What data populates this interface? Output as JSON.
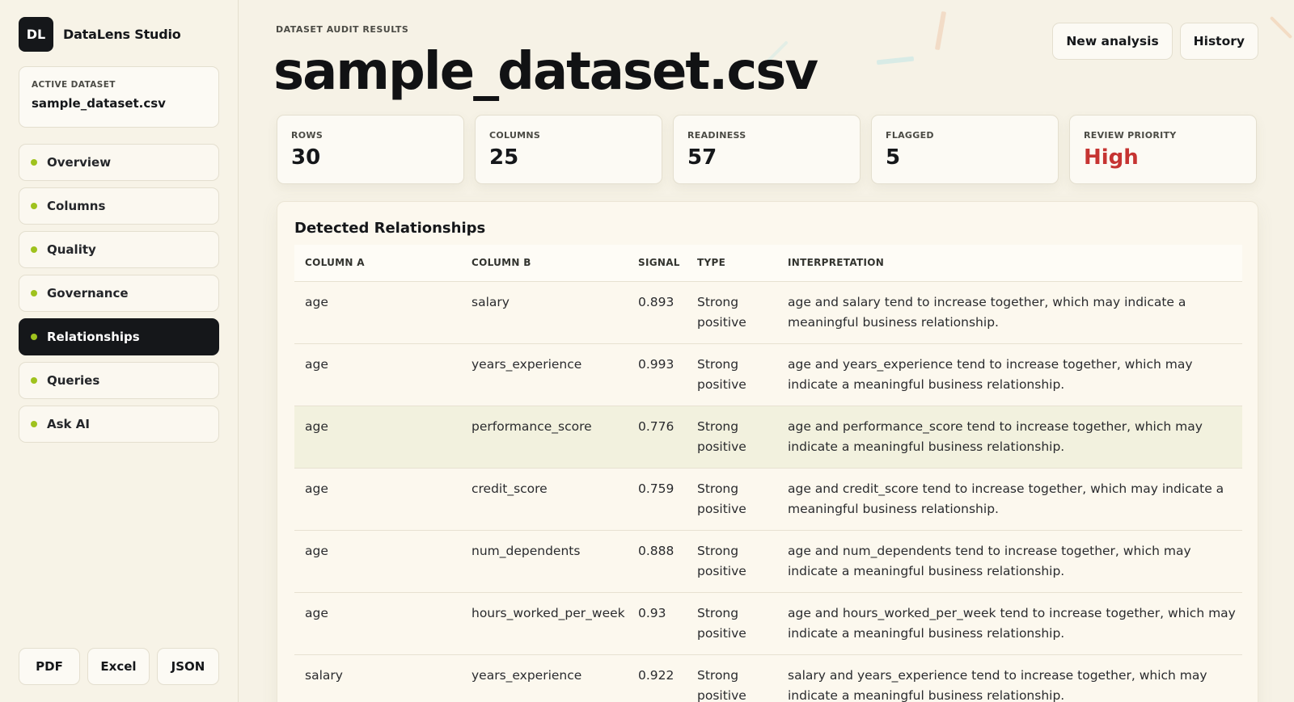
{
  "brand": {
    "logo": "DL",
    "name": "DataLens Studio"
  },
  "active_dataset": {
    "label": "ACTIVE DATASET",
    "value": "sample_dataset.csv"
  },
  "nav": {
    "items": [
      {
        "label": "Overview",
        "active": false
      },
      {
        "label": "Columns",
        "active": false
      },
      {
        "label": "Quality",
        "active": false
      },
      {
        "label": "Governance",
        "active": false
      },
      {
        "label": "Relationships",
        "active": true
      },
      {
        "label": "Queries",
        "active": false
      },
      {
        "label": "Ask AI",
        "active": false
      }
    ]
  },
  "exports": {
    "pdf": "PDF",
    "excel": "Excel",
    "json": "JSON"
  },
  "header": {
    "eyebrow": "DATASET AUDIT RESULTS",
    "title": "sample_dataset.csv",
    "new_analysis": "New analysis",
    "history": "History"
  },
  "stats": [
    {
      "label": "ROWS",
      "value": "30"
    },
    {
      "label": "COLUMNS",
      "value": "25"
    },
    {
      "label": "READINESS",
      "value": "57"
    },
    {
      "label": "FLAGGED",
      "value": "5"
    },
    {
      "label": "REVIEW PRIORITY",
      "value": "High"
    }
  ],
  "relationships": {
    "title": "Detected Relationships",
    "columns": [
      "COLUMN A",
      "COLUMN B",
      "SIGNAL",
      "TYPE",
      "INTERPRETATION"
    ],
    "rows": [
      {
        "a": "age",
        "b": "salary",
        "signal": "0.893",
        "type": "Strong positive",
        "interpretation": "age and salary tend to increase together, which may indicate a meaningful business relationship."
      },
      {
        "a": "age",
        "b": "years_experience",
        "signal": "0.993",
        "type": "Strong positive",
        "interpretation": "age and years_experience tend to increase together, which may indicate a meaningful business relationship."
      },
      {
        "a": "age",
        "b": "performance_score",
        "signal": "0.776",
        "type": "Strong positive",
        "interpretation": "age and performance_score tend to increase together, which may indicate a meaningful business relationship."
      },
      {
        "a": "age",
        "b": "credit_score",
        "signal": "0.759",
        "type": "Strong positive",
        "interpretation": "age and credit_score tend to increase together, which may indicate a meaningful business relationship."
      },
      {
        "a": "age",
        "b": "num_dependents",
        "signal": "0.888",
        "type": "Strong positive",
        "interpretation": "age and num_dependents tend to increase together, which may indicate a meaningful business relationship."
      },
      {
        "a": "age",
        "b": "hours_worked_per_week",
        "signal": "0.93",
        "type": "Strong positive",
        "interpretation": "age and hours_worked_per_week tend to increase together, which may indicate a meaningful business relationship."
      },
      {
        "a": "salary",
        "b": "years_experience",
        "signal": "0.922",
        "type": "Strong positive",
        "interpretation": "salary and years_experience tend to increase together, which may indicate a meaningful business relationship."
      }
    ]
  },
  "colors": {
    "accent_dot": "#9fc21e",
    "priority_high": "#c63432",
    "dark": "#15171a",
    "highlight_row": "#f2f1de"
  }
}
